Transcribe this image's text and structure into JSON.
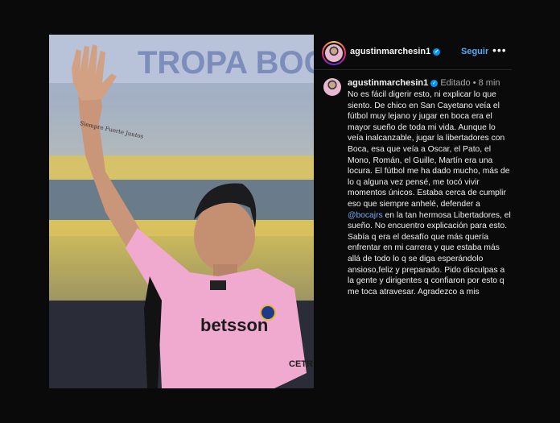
{
  "post": {
    "username": "agustinmarchesin1",
    "follow_label": "Seguir",
    "more_label": "•••",
    "verified_mark": "✓",
    "photo": {
      "jersey_sponsor": "betsson",
      "jersey_sleeve_text": "CETR",
      "tattoo_text": "Siempre Fuerte Juntos",
      "stadium_text": "TROPA BOC"
    }
  },
  "caption": {
    "username": "agustinmarchesin1",
    "edited_label": "Editado",
    "separator": "•",
    "time": "8 min",
    "text_before_mention": "No es fácil digerir esto, ni explicar lo que siento. De chico en San Cayetano veía el fútbol muy lejano y jugar en boca era el mayor sueño de toda mi vida. Aunque lo veía inalcanzable, jugar la libertadores con Boca, esa que veía a Oscar, el Pato, el Mono, Román, el Guille, Martín era una locura. El fútbol me ha dado mucho, más de lo q alguna vez pensé, me tocó vivir momentos únicos. Estaba cerca de cumplir eso que siempre anhelé, defender a ",
    "mention": "@bocajrs",
    "text_after_mention": " en la tan hermosa Libertadores, el sueño. No encuentro explicación para esto. Sabía q era el desafío que más quería enfrentar en mi carrera y que estaba más allá de todo lo q se diga esperándolo ansioso,feliz y preparado. Pido disculpas a la gente y dirigentes q confiaron por esto q me toca atravesar. Agradezco a mis"
  },
  "icons": {
    "verified": "verified-badge-icon",
    "more": "more-options-icon"
  },
  "colors": {
    "background": "#0a0a0a",
    "accent_link": "#5aa9f6",
    "mention": "#7aa7f3",
    "verified": "#0095f6",
    "jersey_pink": "#f0a9cf"
  }
}
